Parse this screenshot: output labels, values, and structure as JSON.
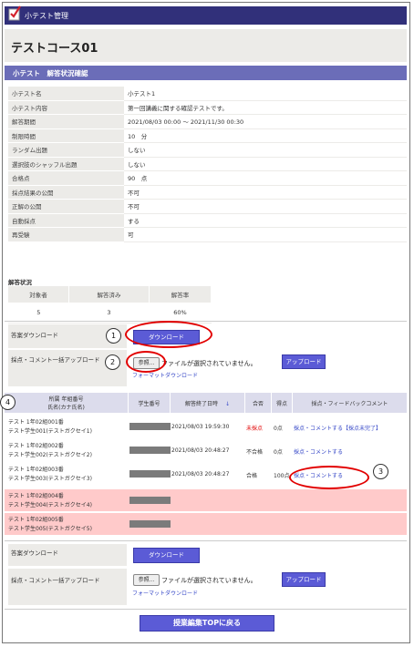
{
  "header": {
    "title": "小テスト管理"
  },
  "course": {
    "name": "テストコース01"
  },
  "section": {
    "title": "小テスト　解答状況確認"
  },
  "info": [
    {
      "label": "小テスト名",
      "value": "小テスト1"
    },
    {
      "label": "小テスト内容",
      "value": "第一回講義に関する確認テストです。"
    },
    {
      "label": "解答期間",
      "value": "2021/08/03  00:00  ～  2021/11/30 00:30"
    },
    {
      "label": "制限時間",
      "value": "10　分"
    },
    {
      "label": "ランダム出題",
      "value": "しない"
    },
    {
      "label": "選択肢のシャッフル出題",
      "value": "しない"
    },
    {
      "label": "合格点",
      "value": "90　点"
    },
    {
      "label": "採点結果の公開",
      "value": "不可"
    },
    {
      "label": "正解の公開",
      "value": "不可"
    },
    {
      "label": "自動採点",
      "value": "する"
    },
    {
      "label": "再受験",
      "value": "可"
    }
  ],
  "stats": {
    "title": "解答状況",
    "headers": [
      "対象者",
      "解答済み",
      "解答率"
    ],
    "values": [
      "5",
      "3",
      "60%"
    ]
  },
  "upload": {
    "download_label": "答案ダウンロード",
    "download_button": "ダウンロード",
    "bulk_label": "採点・コメント一括アップロード",
    "browse": "参照...",
    "no_file": "ファイルが選択されていません。",
    "upload_button": "アップロード",
    "format_link": "フォーマットダウンロード"
  },
  "annotations": [
    "1",
    "2",
    "3",
    "4"
  ],
  "table": {
    "headers": {
      "name": "所属 年組番号\n氏名(カナ氏名)",
      "id": "学生番号",
      "date": "解答終了日時",
      "sort": "↓",
      "result": "合否",
      "score": "得点",
      "feedback": "採点・フィードバックコメント"
    },
    "rows": [
      {
        "line1": "テスト 1年02組001番",
        "line2": "テスト学生001(テストガクセイ1)",
        "date": "2021/08/03 19:59:30",
        "result": "未採点",
        "score": "0点",
        "feedback": "採点・コメントする【採点未完了】"
      },
      {
        "line1": "テスト 1年02組002番",
        "line2": "テスト学生002(テストガクセイ2)",
        "date": "2021/08/03 20:48:27",
        "result": "不合格",
        "score": "0点",
        "feedback": "採点・コメントする"
      },
      {
        "line1": "テスト 1年02組003番",
        "line2": "テスト学生003(テストガクセイ3)",
        "date": "2021/08/03 20:48:27",
        "result": "合格",
        "score": "100点",
        "feedback": "採点・コメントする"
      },
      {
        "line1": "テスト 1年02組004番",
        "line2": "テスト学生004(テストガクセイ4)",
        "date": "",
        "result": "",
        "score": "",
        "feedback": ""
      },
      {
        "line1": "テスト 1年02組005番",
        "line2": "テスト学生005(テストガクセイ5)",
        "date": "",
        "result": "",
        "score": "",
        "feedback": ""
      }
    ]
  },
  "footer": {
    "top_button": "授業編集TOPに戻る"
  },
  "colors": {
    "accent": "#31307a",
    "section": "#6b6db8",
    "button": "#5b5bd6",
    "pending": "#ffcaca",
    "alert": "#e20000"
  }
}
